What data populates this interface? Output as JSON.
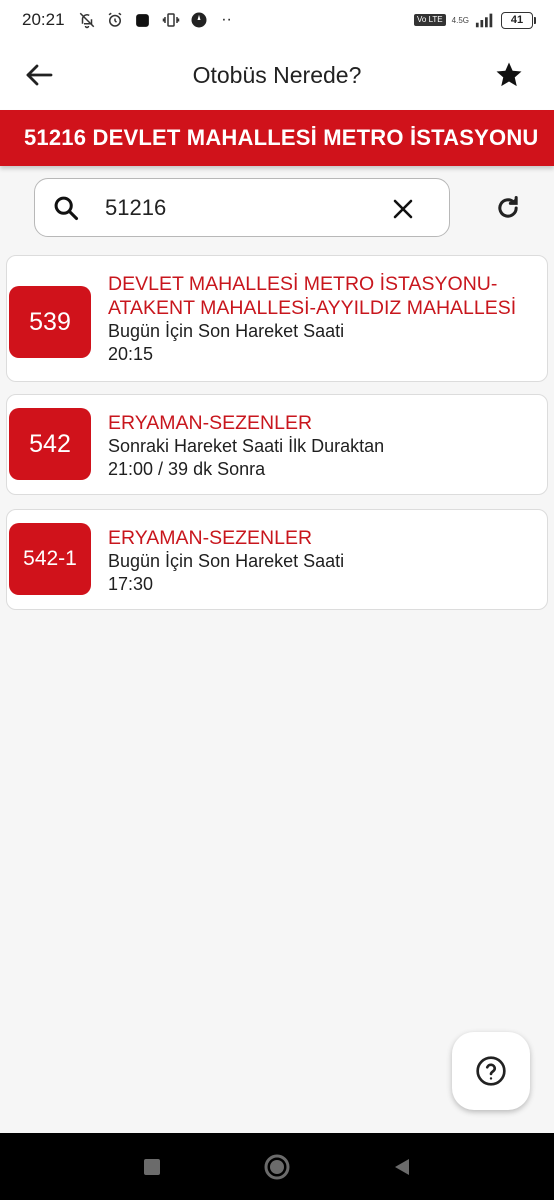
{
  "status_bar": {
    "time": "20:21",
    "network_label": "4.5G",
    "volte_label": "Vo LTE",
    "battery": "41",
    "left_icons": [
      "bell-off-icon",
      "alarm-icon",
      "app-square-icon",
      "vibrate-icon",
      "compass-icon",
      "more-dots-icon"
    ],
    "more_dots": "··"
  },
  "app_bar": {
    "title": "Otobüs Nerede?",
    "back_icon": "arrow-left-icon",
    "favorite_icon": "star-icon"
  },
  "banner": {
    "text": "51216 DEVLET MAHALLESİ METRO İSTASYONU"
  },
  "search": {
    "value": "51216",
    "search_icon": "search-icon",
    "clear_icon": "close-icon",
    "refresh_icon": "refresh-icon"
  },
  "routes": [
    {
      "number": "539",
      "name_line1": "DEVLET MAHALLESİ METRO İSTASYONU-",
      "name_line2": "ATAKENT MAHALLESİ-AYYILDIZ MAHALLESİ",
      "info_line1": "Bugün İçin Son Hareket Saati",
      "info_line2": "20:15"
    },
    {
      "number": "542",
      "name_line1": "ERYAMAN-SEZENLER",
      "info_line1": "Sonraki Hareket Saati İlk Duraktan",
      "info_line2": "21:00 / 39 dk Sonra"
    },
    {
      "number": "542-1",
      "name_line1": "ERYAMAN-SEZENLER",
      "info_line1": "Bugün İçin Son Hareket Saati",
      "info_line2": "17:30"
    }
  ],
  "help_button": {
    "icon": "help-circle-icon"
  },
  "nav_bar": {
    "icons": [
      "square-icon",
      "circle-icon",
      "triangle-back-icon"
    ]
  },
  "colors": {
    "brand_red": "#d0121b",
    "route_name_red": "#c8161d",
    "background": "#f6f6f6",
    "card_background": "#ffffff"
  }
}
